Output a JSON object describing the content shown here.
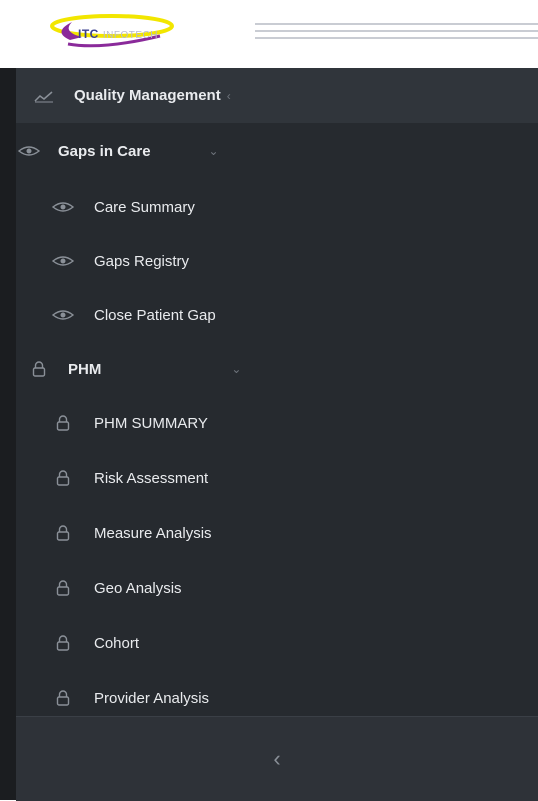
{
  "brand": {
    "logo_text": "ITC",
    "logo_sub": "INFOTECH"
  },
  "sidebar": {
    "section_title": "Quality Management",
    "section_chevron": "‹",
    "groups": [
      {
        "label": "Gaps in Care",
        "icon": "eye-icon",
        "chevron": "⌄",
        "items": [
          {
            "label": "Care Summary",
            "icon": "eye-icon"
          },
          {
            "label": "Gaps Registry",
            "icon": "eye-icon"
          },
          {
            "label": "Close Patient Gap",
            "icon": "eye-icon"
          }
        ]
      },
      {
        "label": "PHM",
        "icon": "lock-icon",
        "chevron": "⌄",
        "items": [
          {
            "label": "PHM SUMMARY",
            "icon": "lock-icon"
          },
          {
            "label": "Risk Assessment",
            "icon": "lock-icon"
          },
          {
            "label": "Measure Analysis",
            "icon": "lock-icon"
          },
          {
            "label": "Geo Analysis",
            "icon": "lock-icon"
          },
          {
            "label": "Cohort",
            "icon": "lock-icon"
          },
          {
            "label": "Provider Analysis",
            "icon": "lock-icon"
          }
        ]
      }
    ],
    "collapse_glyph": "‹"
  },
  "colors": {
    "sidebar_bg": "#262a2f",
    "section_bg": "#30353b",
    "outer_bg": "#1b1d20",
    "text": "#e9ebee",
    "icon": "#8a9098",
    "logo_swoosh": "#8a2a9a",
    "logo_accent": "#f2e600"
  }
}
